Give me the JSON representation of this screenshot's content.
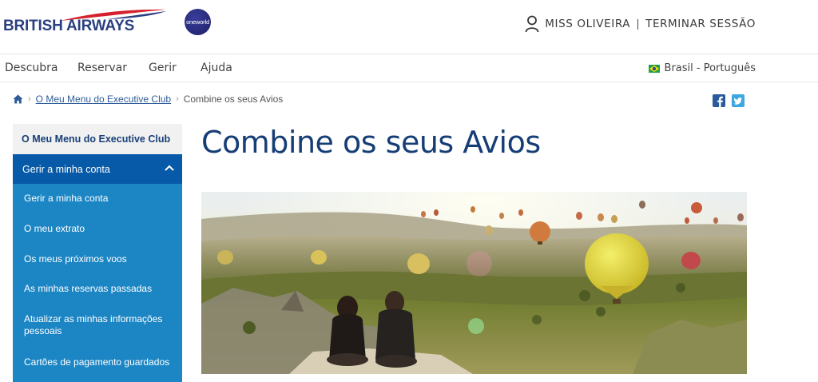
{
  "header": {
    "brand_name": "BRITISH AIRWAYS",
    "alliance_badge": "oneworld",
    "user_icon": "user-icon",
    "user_name": "MISS OLIVEIRA",
    "logout_label": "TERMINAR SESSÃO"
  },
  "nav": {
    "items": [
      {
        "label": "Descubra"
      },
      {
        "label": "Reservar"
      },
      {
        "label": "Gerir"
      },
      {
        "label": "Ajuda"
      }
    ],
    "language": "Brasil - Português",
    "language_flag_icon": "brazil-flag-icon"
  },
  "breadcrumb": {
    "home_icon": "home-icon",
    "items": [
      {
        "label": "O Meu Menu do Executive Club"
      },
      {
        "label": "Combine os seus Avios"
      }
    ]
  },
  "social": [
    "facebook-icon",
    "twitter-icon"
  ],
  "sidebar": {
    "title": "O Meu Menu do Executive Club",
    "section_label": "Gerir a minha conta",
    "section_expanded": true,
    "items": [
      {
        "label": "Gerir a minha conta"
      },
      {
        "label": "O meu extrato"
      },
      {
        "label": "Os meus próximos voos"
      },
      {
        "label": "As minhas reservas passadas"
      },
      {
        "label": "Atualizar as minhas informações pessoais"
      },
      {
        "label": "Cartões de pagamento guardados"
      }
    ]
  },
  "main": {
    "title": "Combine os seus Avios",
    "hero_image": "hot-air-balloons-landscape-photo"
  },
  "colors": {
    "brand_navy": "#163e76",
    "sidebar_blue": "#1c86c4",
    "sidebar_section": "#075aa8",
    "link_blue": "#2e5c99",
    "speedmarque_red": "#d5212e"
  }
}
